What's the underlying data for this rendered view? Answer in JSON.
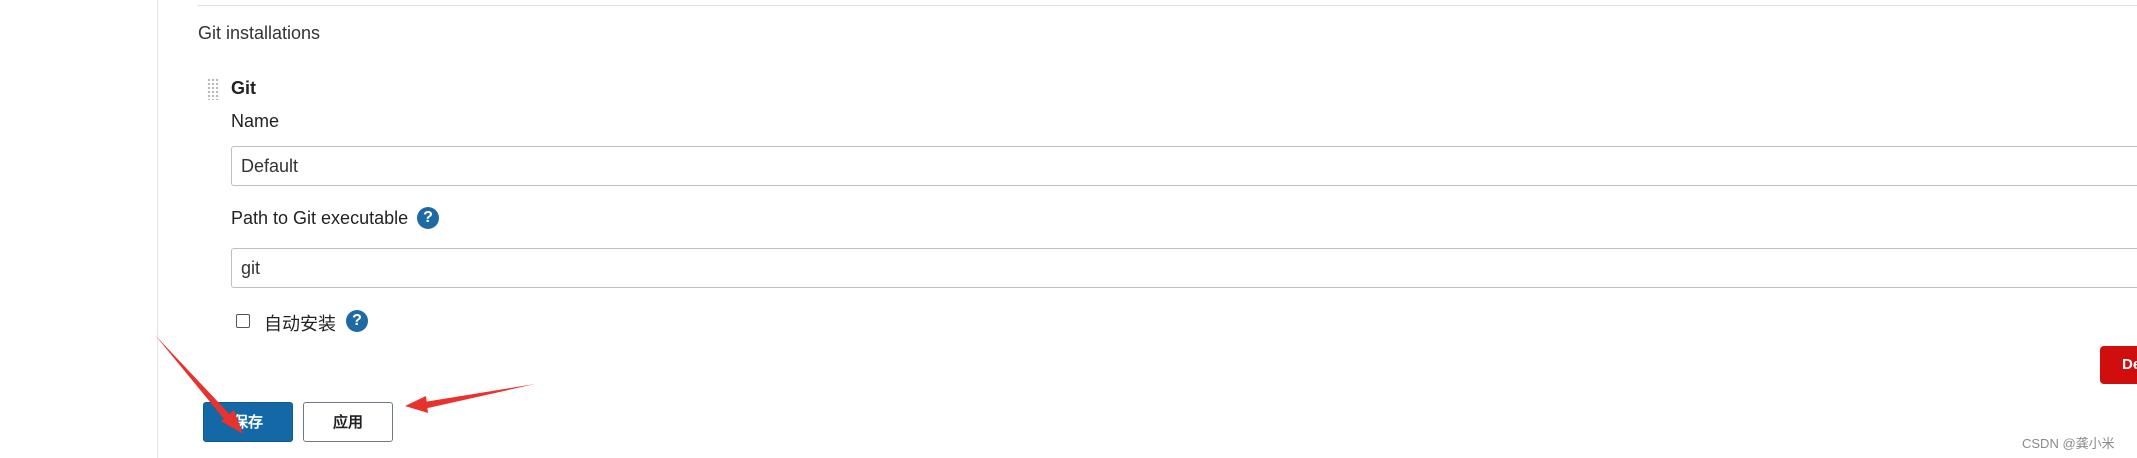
{
  "section": {
    "title": "Git installations"
  },
  "tool": {
    "title": "Git",
    "name_label": "Name",
    "name_value": "Default",
    "path_label": "Path to Git executable",
    "path_value": "git",
    "auto_install_label": "自动安装",
    "auto_install_checked": false,
    "help_icon": "question-mark-icon",
    "delete_label": "Delete"
  },
  "actions": {
    "save_label": "保存",
    "apply_label": "应用"
  },
  "watermark": "CSDN @龚小米",
  "colors": {
    "primary": "#1468a6",
    "help": "#1f6aa5",
    "delete": "#d00e0e",
    "annotation_arrow": "#e8322d"
  }
}
